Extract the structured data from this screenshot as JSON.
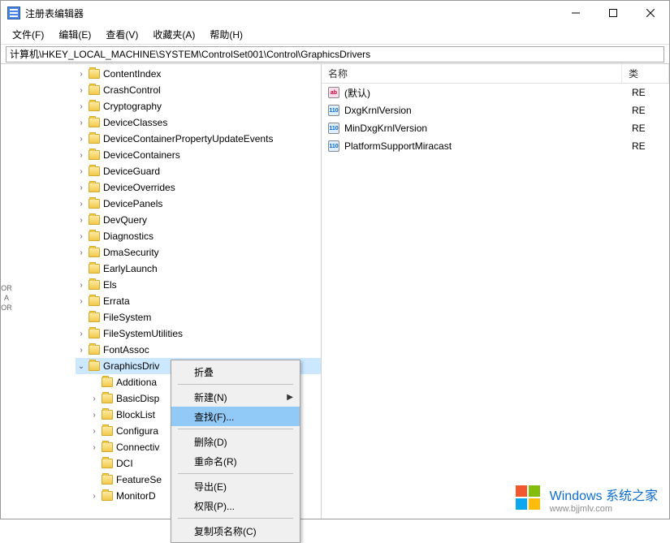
{
  "window": {
    "title": "注册表编辑器"
  },
  "menubar": {
    "file": "文件(F)",
    "edit": "编辑(E)",
    "view": "查看(V)",
    "favorites": "收藏夹(A)",
    "help": "帮助(H)"
  },
  "address": "计算机\\HKEY_LOCAL_MACHINE\\SYSTEM\\ControlSet001\\Control\\GraphicsDrivers",
  "tree": [
    {
      "label": "ContentIndex",
      "exp": true
    },
    {
      "label": "CrashControl",
      "exp": true
    },
    {
      "label": "Cryptography",
      "exp": true
    },
    {
      "label": "DeviceClasses",
      "exp": true
    },
    {
      "label": "DeviceContainerPropertyUpdateEvents",
      "exp": true
    },
    {
      "label": "DeviceContainers",
      "exp": true
    },
    {
      "label": "DeviceGuard",
      "exp": true
    },
    {
      "label": "DeviceOverrides",
      "exp": true
    },
    {
      "label": "DevicePanels",
      "exp": true
    },
    {
      "label": "DevQuery",
      "exp": true
    },
    {
      "label": "Diagnostics",
      "exp": true
    },
    {
      "label": "DmaSecurity",
      "exp": true
    },
    {
      "label": "EarlyLaunch",
      "exp": false
    },
    {
      "label": "Els",
      "exp": true
    },
    {
      "label": "Errata",
      "exp": true
    },
    {
      "label": "FileSystem",
      "exp": false
    },
    {
      "label": "FileSystemUtilities",
      "exp": true
    },
    {
      "label": "FontAssoc",
      "exp": true
    },
    {
      "label": "GraphicsDriv",
      "exp": true,
      "expanded": true,
      "selected": true
    }
  ],
  "tree_children": [
    {
      "label": "Additiona",
      "exp": false
    },
    {
      "label": "BasicDisp",
      "exp": true
    },
    {
      "label": "BlockList",
      "exp": true
    },
    {
      "label": "Configura",
      "exp": true
    },
    {
      "label": "Connectiv",
      "exp": true
    },
    {
      "label": "DCI",
      "exp": false
    },
    {
      "label": "FeatureSe",
      "exp": false
    },
    {
      "label": "MonitorD",
      "exp": true
    }
  ],
  "list": {
    "cols": {
      "name": "名称",
      "type": "类"
    },
    "rows": [
      {
        "icon": "str",
        "name": "(默认)",
        "type": "RE"
      },
      {
        "icon": "bin",
        "name": "DxgKrnlVersion",
        "type": "RE"
      },
      {
        "icon": "bin",
        "name": "MinDxgKrnlVersion",
        "type": "RE"
      },
      {
        "icon": "bin",
        "name": "PlatformSupportMiracast",
        "type": "RE"
      }
    ]
  },
  "context_menu": {
    "collapse": "折叠",
    "new": "新建(N)",
    "find": "查找(F)...",
    "delete": "删除(D)",
    "rename": "重命名(R)",
    "export": "导出(E)",
    "permissions": "权限(P)...",
    "copy_key_name": "复制项名称(C)"
  },
  "watermark": {
    "title": "Windows 系统之家",
    "sub": "www.bjjmlv.com"
  },
  "gutter": {
    "l1": "OR",
    "l2": "A",
    "l3": "OR"
  }
}
